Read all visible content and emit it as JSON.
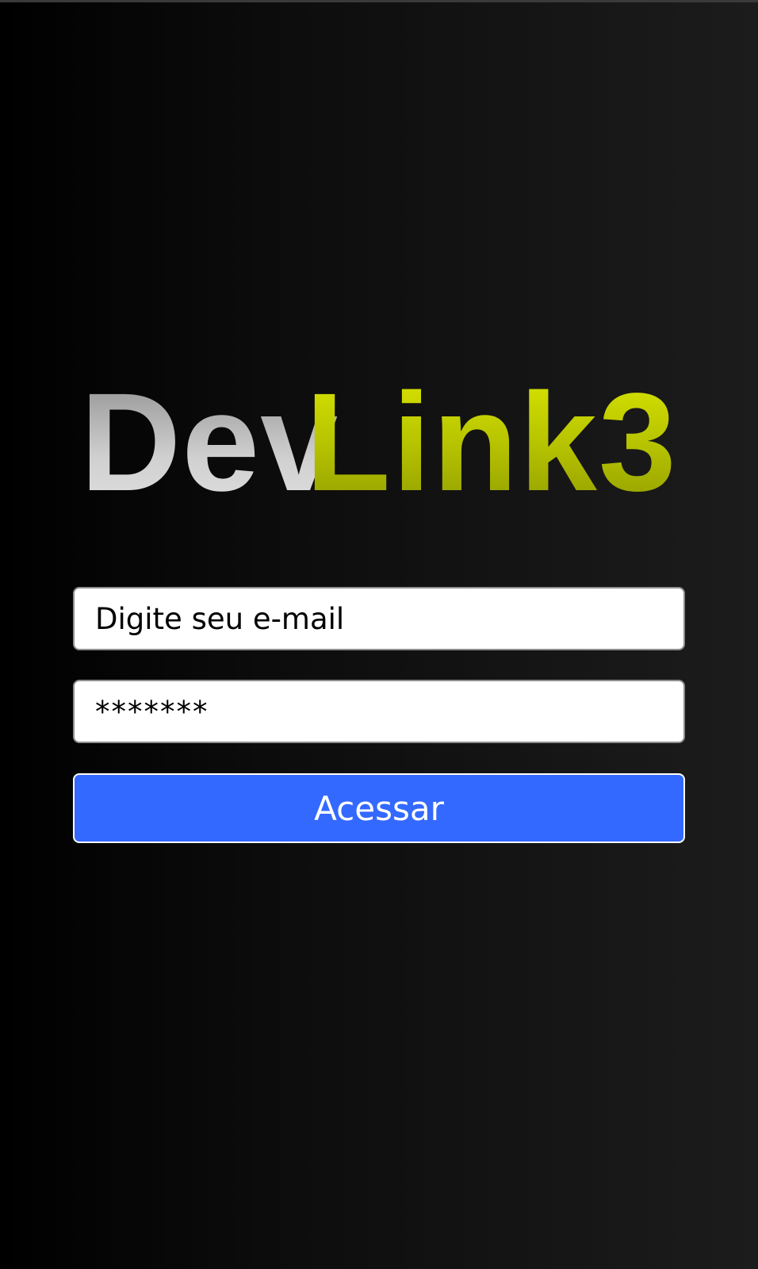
{
  "logo": {
    "part_1": "Dev",
    "part_2": "Link3"
  },
  "login_form": {
    "email_placeholder": "Digite seu e-mail",
    "password_value": "*******",
    "submit_label": "Acessar"
  },
  "colors": {
    "background": "#000000",
    "logo_dev": "#d0d0d0",
    "logo_link": "#c9d600",
    "button": "#3469ff"
  }
}
